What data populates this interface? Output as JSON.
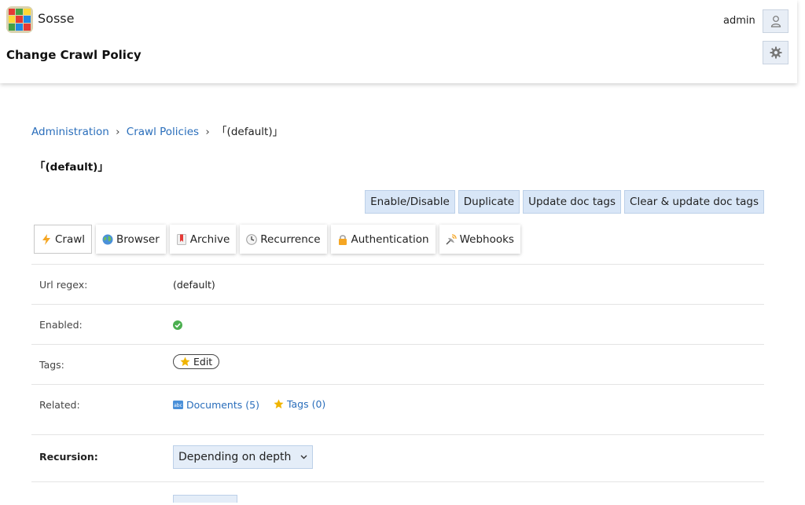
{
  "app": {
    "name": "Sosse"
  },
  "header": {
    "title": "Change Crawl Policy",
    "username": "admin"
  },
  "breadcrumb": [
    {
      "label": "Administration"
    },
    {
      "label": "Crawl Policies"
    },
    {
      "label": "「(default)」"
    }
  ],
  "breadcrumb_sep": "›",
  "policy": {
    "heading": "「(default)」"
  },
  "actions": [
    "Enable/Disable",
    "Duplicate",
    "Update doc tags",
    "Clear & update doc tags"
  ],
  "tabs": [
    {
      "label": "Crawl",
      "icon": "lightning-icon"
    },
    {
      "label": "Browser",
      "icon": "globe-icon"
    },
    {
      "label": "Archive",
      "icon": "bookmark-icon"
    },
    {
      "label": "Recurrence",
      "icon": "clock-icon"
    },
    {
      "label": "Authentication",
      "icon": "lock-icon"
    },
    {
      "label": "Webhooks",
      "icon": "satellite-icon"
    }
  ],
  "fields": {
    "url_regex": {
      "label": "Url regex:",
      "value": "(default)"
    },
    "enabled": {
      "label": "Enabled:",
      "value": "check-icon"
    },
    "tags": {
      "label": "Tags:",
      "button": "Edit"
    },
    "related": {
      "label": "Related:",
      "documents": "Documents (5)",
      "tags": "Tags (0)"
    },
    "recursion": {
      "label": "Recursion:",
      "value": "Depending on depth"
    }
  },
  "colors": {
    "link": "#2a6ebb",
    "button_bg": "#d8e6f7",
    "check": "#4caf50"
  }
}
